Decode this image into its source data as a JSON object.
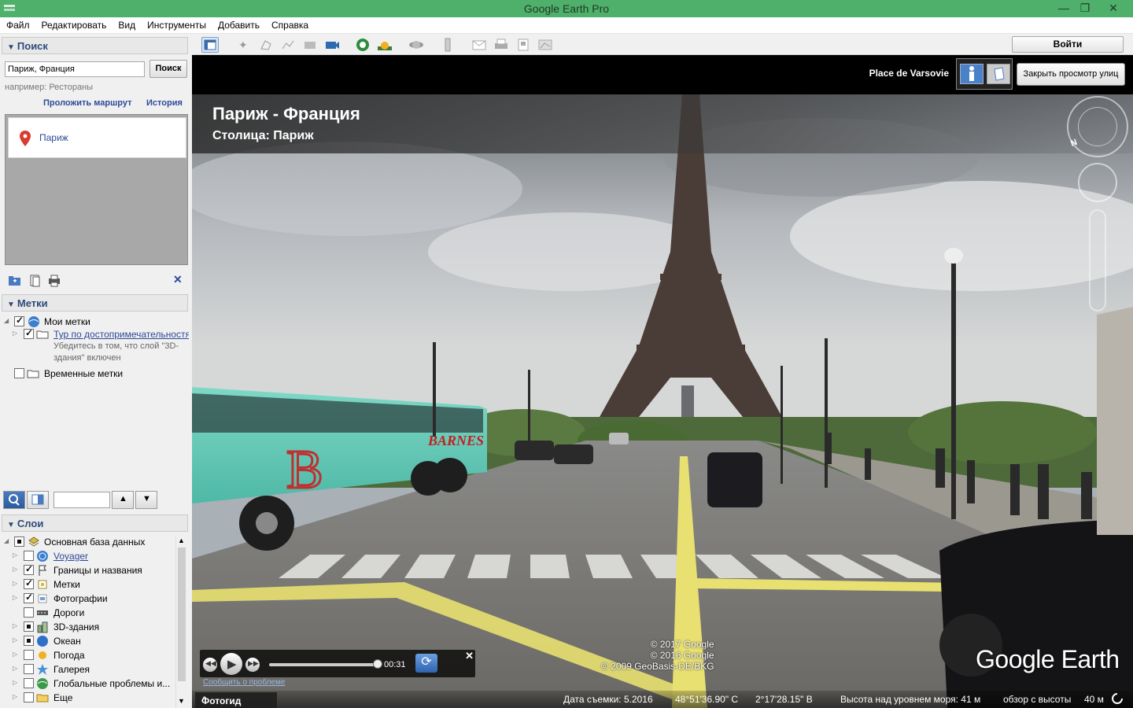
{
  "window": {
    "title": "Google Earth Pro"
  },
  "menu": [
    "Файл",
    "Редактировать",
    "Вид",
    "Инструменты",
    "Добавить",
    "Справка"
  ],
  "search": {
    "header": "Поиск",
    "value": "Париж, Франция",
    "button": "Поиск",
    "hint": "например: Рестораны",
    "route_link": "Проложить маршрут",
    "history_link": "История",
    "result": "Париж"
  },
  "places": {
    "header": "Метки",
    "items": [
      {
        "label": "Мои метки"
      },
      {
        "label": "Тур по достопримечательностям",
        "sub": [
          "Убедитесь в том, что слой \"3D-",
          "здания\" включен"
        ]
      },
      {
        "label": "Временные метки"
      }
    ]
  },
  "layers": {
    "header": "Слои",
    "items": [
      {
        "label": "Основная база данных"
      },
      {
        "label": "Voyager"
      },
      {
        "label": "Границы и названия"
      },
      {
        "label": "Метки"
      },
      {
        "label": "Фотографии"
      },
      {
        "label": "Дороги"
      },
      {
        "label": "3D-здания"
      },
      {
        "label": "Океан"
      },
      {
        "label": "Погода"
      },
      {
        "label": "Галерея"
      },
      {
        "label": "Глобальные проблемы и..."
      },
      {
        "label": "Еще"
      }
    ]
  },
  "toolbar": {
    "login": "Войти"
  },
  "streetview": {
    "place_name": "Place de Varsovie",
    "close_button": "Закрыть просмотр улиц",
    "title": "Париж - Франция",
    "subtitle": "Столица: Париж",
    "north_label": "N"
  },
  "player": {
    "time": "00:31",
    "close": "✕",
    "report": "Сообщить о проблеме"
  },
  "copyright": [
    "© 2017 Google",
    "© 2016 Google",
    "© 2009 GeoBasis-DE/BKG"
  ],
  "logo": "Google Earth",
  "status": {
    "photo_tab": "Фотогид",
    "date": "Дата съемки: 5.2016",
    "lat": "48°51'36.90\" С",
    "lon": "2°17'28.15\" В",
    "elevation": "Высота над уровнем моря:   41 м",
    "eye": "обзор с высоты",
    "eye_value": "40 м"
  }
}
